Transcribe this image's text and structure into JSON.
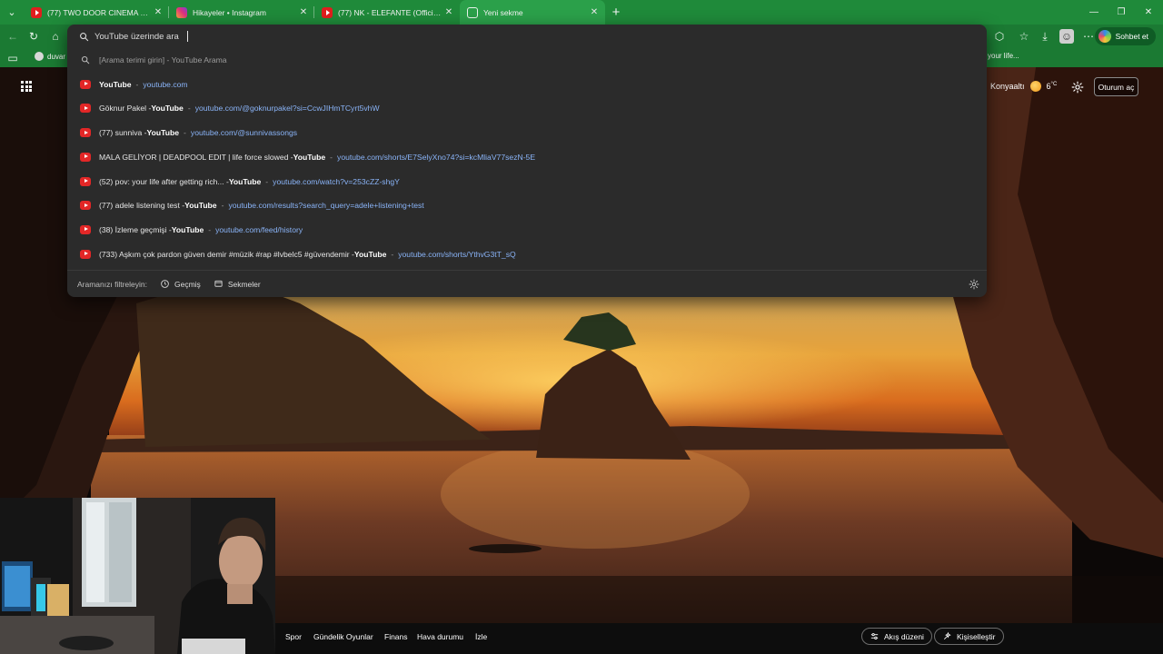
{
  "browser": {
    "tabs": [
      {
        "title": "(77) TWO DOOR CINEMA CLUB | S",
        "icon": "youtube-icon",
        "active": false
      },
      {
        "title": "Hikayeler • Instagram",
        "icon": "instagram-icon",
        "active": false
      },
      {
        "title": "(77) NK - ELEFANTE (Official Vide",
        "icon": "youtube-icon",
        "active": false
      },
      {
        "title": "Yeni sekme",
        "icon": "new-tab-page-icon",
        "active": true
      }
    ],
    "new_tab_symbol": "+",
    "chat_button_label": "Sohbet et",
    "favorites": [
      {
        "label": "duvar"
      },
      {
        "label": "your life..."
      }
    ]
  },
  "omnibox": {
    "query_placeholder": "YouTube üzerinde ara",
    "suggestions": [
      {
        "type": "search",
        "icon": "search-icon",
        "parts": [
          {
            "text": "[Arama terimi girin] - YouTube Arama",
            "style": "muted"
          }
        ]
      },
      {
        "type": "site",
        "icon": "youtube-icon",
        "parts": [
          {
            "text": "YouTube",
            "style": "bold"
          },
          {
            "text": "-",
            "style": "dash"
          },
          {
            "text": "youtube.com",
            "style": "link"
          }
        ]
      },
      {
        "type": "history",
        "icon": "youtube-icon",
        "parts": [
          {
            "text": "Göknur Pakel - ",
            "style": "plain"
          },
          {
            "text": "YouTube",
            "style": "bold"
          },
          {
            "text": "-",
            "style": "dash"
          },
          {
            "text": "youtube.com/@goknurpakel?si=CcwJIHmTCyrt5vhW",
            "style": "link"
          }
        ]
      },
      {
        "type": "history",
        "icon": "youtube-icon",
        "parts": [
          {
            "text": "(77) sunniva - ",
            "style": "plain"
          },
          {
            "text": "YouTube",
            "style": "bold"
          },
          {
            "text": "-",
            "style": "dash"
          },
          {
            "text": "youtube.com/@sunnivassongs",
            "style": "link"
          }
        ]
      },
      {
        "type": "history",
        "icon": "youtube-icon",
        "parts": [
          {
            "text": "MALA GELİYOR | DEADPOOL EDIT | life force slowed - ",
            "style": "plain"
          },
          {
            "text": "YouTube",
            "style": "bold"
          },
          {
            "text": "-",
            "style": "dash"
          },
          {
            "text": "youtube.com/shorts/E7SelyXno74?si=kcMliaV77sezN-5E",
            "style": "link"
          }
        ]
      },
      {
        "type": "history",
        "icon": "youtube-icon",
        "parts": [
          {
            "text": "(52) pov: your life after getting rich... - ",
            "style": "plain"
          },
          {
            "text": "YouTube",
            "style": "bold"
          },
          {
            "text": "-",
            "style": "dash"
          },
          {
            "text": "youtube.com/watch?v=253cZZ-shgY",
            "style": "link"
          }
        ]
      },
      {
        "type": "history",
        "icon": "youtube-icon",
        "parts": [
          {
            "text": "(77) adele listening test - ",
            "style": "plain"
          },
          {
            "text": "YouTube",
            "style": "bold"
          },
          {
            "text": "-",
            "style": "dash"
          },
          {
            "text": "youtube.com/results?search_query=adele+listening+test",
            "style": "link"
          }
        ]
      },
      {
        "type": "history",
        "icon": "youtube-icon",
        "parts": [
          {
            "text": "(38) İzleme geçmişi - ",
            "style": "plain"
          },
          {
            "text": "YouTube",
            "style": "bold"
          },
          {
            "text": "-",
            "style": "dash"
          },
          {
            "text": "youtube.com/feed/history",
            "style": "link"
          }
        ]
      },
      {
        "type": "history",
        "icon": "youtube-icon",
        "parts": [
          {
            "text": "(733) Aşkım çok pardon güven demir #müzik #rap #lvbelc5 #güvendemir - ",
            "style": "plain"
          },
          {
            "text": "YouTube",
            "style": "bold"
          },
          {
            "text": "-",
            "style": "dash"
          },
          {
            "text": "youtube.com/shorts/YthvG3tT_sQ",
            "style": "link"
          }
        ]
      }
    ],
    "filter_label": "Aramanızı filtreleyin:",
    "filters": [
      {
        "label": "Geçmiş",
        "icon": "history-icon"
      },
      {
        "label": "Sekmeler",
        "icon": "tabs-icon"
      }
    ]
  },
  "new_tab_page": {
    "weather_location": "Konyaaltı",
    "weather_temp": "6",
    "weather_unit": "°C",
    "login_label": "Oturum aç",
    "bottom_nav": [
      "Spor",
      "Gündelik Oyunlar",
      "Finans",
      "Hava durumu",
      "İzle"
    ],
    "feed_layout_label": "Akış düzeni",
    "personalize_label": "Kişiselleştir"
  },
  "colors": {
    "tab_bar": "#1f8a3a",
    "active_tab": "#2ba04a",
    "omnibox_bg": "#2b2b2b",
    "link": "#8ab4f8",
    "youtube_red": "#e32727"
  }
}
